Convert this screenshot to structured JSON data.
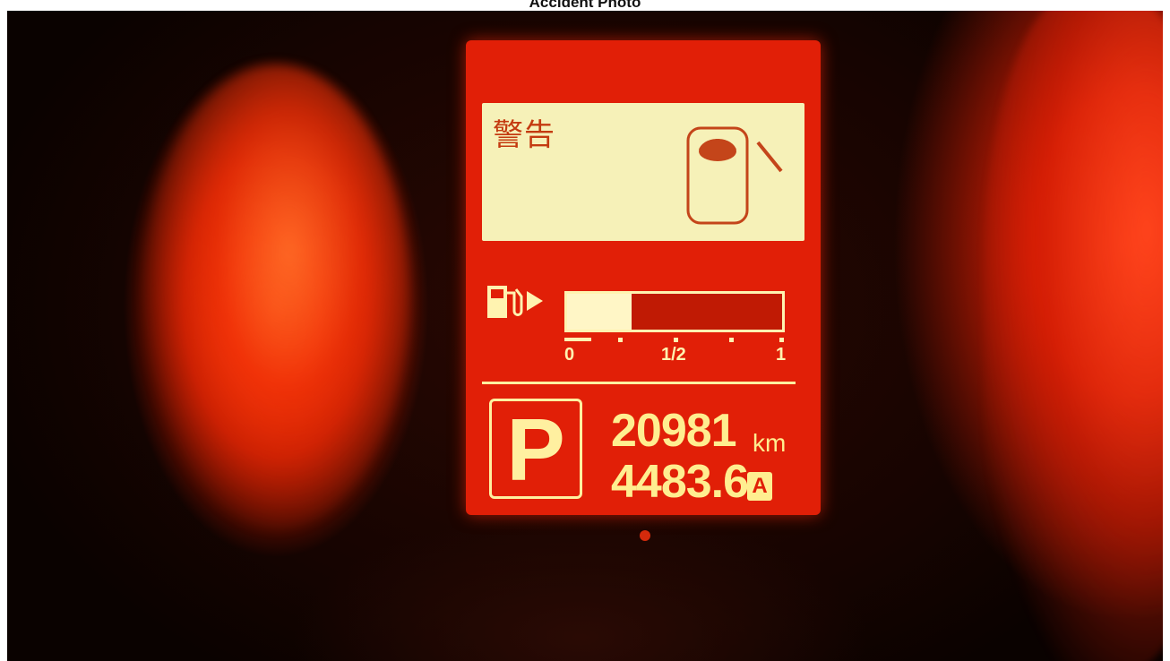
{
  "caption": {
    "title": "Accident Photo"
  },
  "display": {
    "warning_text": "警告",
    "fuel": {
      "level": 0.3,
      "scale_labels": [
        "0",
        "1/2",
        "1"
      ]
    },
    "gear": "P",
    "odometer": {
      "value": "20981",
      "unit": "km"
    },
    "trip": {
      "value": "4483.6",
      "label": "A"
    },
    "icons": [
      "door-open-icon",
      "fuel-pump-icon"
    ],
    "colors": {
      "panel_red": "#e11f07",
      "panel_cream": "#f6f1b8",
      "digit_yellow": "#ffee90"
    }
  }
}
